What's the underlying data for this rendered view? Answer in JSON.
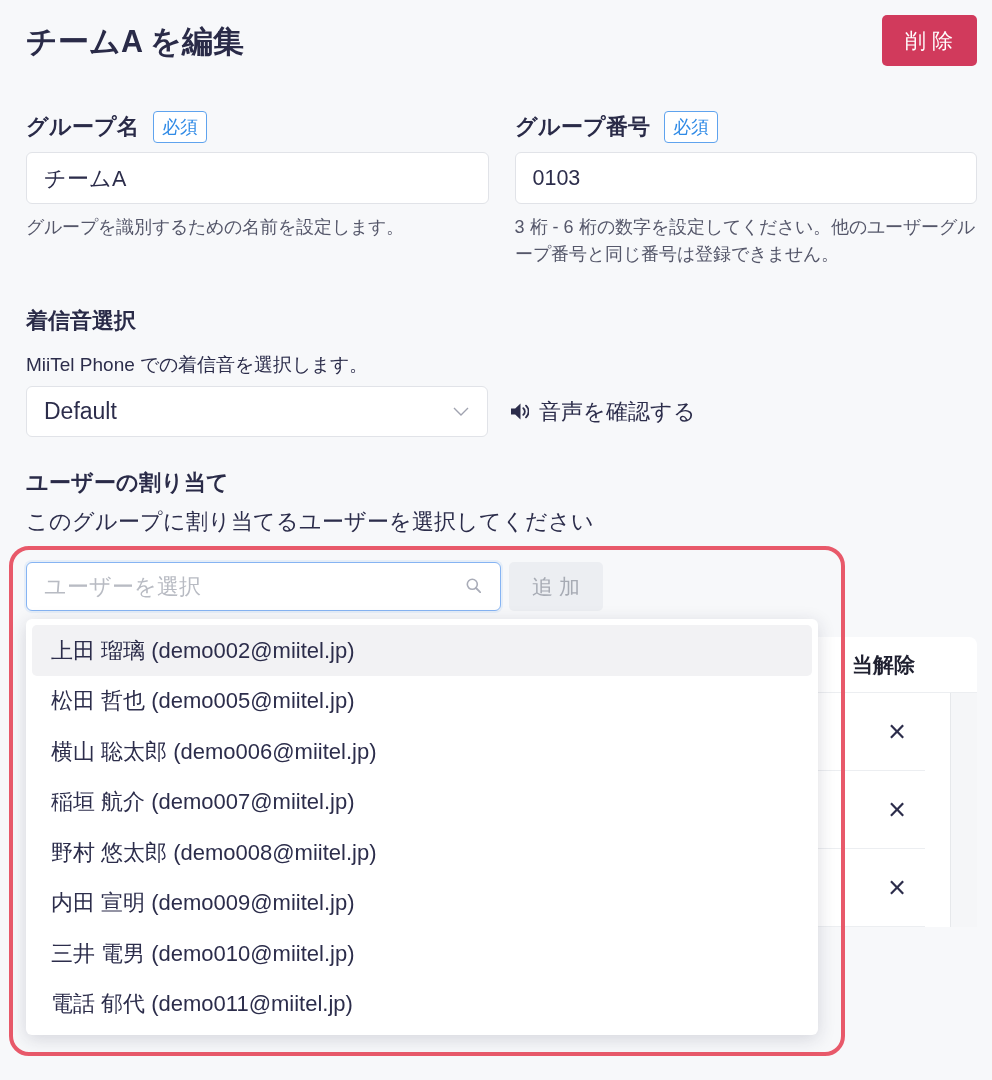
{
  "page": {
    "title": "チームA を編集",
    "delete_button": "削除"
  },
  "group_name": {
    "label": "グループ名",
    "badge": "必須",
    "value": "チームA",
    "help": "グループを識別するための名前を設定します。"
  },
  "group_number": {
    "label": "グループ番号",
    "badge": "必須",
    "value": "0103",
    "help": "3 桁 - 6 桁の数字を設定してください。他のユーザーグループ番号と同じ番号は登録できません。"
  },
  "ringtone": {
    "label": "着信音選択",
    "description": "MiiTel Phone での着信音を選択します。",
    "value": "Default",
    "preview_link": "音声を確認する"
  },
  "user_assignment": {
    "label": "ユーザーの割り当て",
    "description": "このグループに割り当てるユーザーを選択してください",
    "highlighted": true,
    "search": {
      "placeholder": "ユーザーを選択",
      "focused": true
    },
    "add_button": {
      "label": "追加",
      "disabled": true
    },
    "dropdown": {
      "items": [
        {
          "name": "上田 瑠璃 (demo002@miitel.jp)",
          "selected": true
        },
        {
          "name": "松田 哲也 (demo005@miitel.jp)",
          "selected": false
        },
        {
          "name": "横山 聡太郎 (demo006@miitel.jp)",
          "selected": false
        },
        {
          "name": "稲垣 航介 (demo007@miitel.jp)",
          "selected": false
        },
        {
          "name": "野村 悠太郎 (demo008@miitel.jp)",
          "selected": false
        },
        {
          "name": "内田 宣明 (demo009@miitel.jp)",
          "selected": false
        },
        {
          "name": "三井 電男 (demo010@miitel.jp)",
          "selected": false
        },
        {
          "name": "電話 郁代 (demo011@miitel.jp)",
          "selected": false
        }
      ]
    },
    "table": {
      "columns": [
        "当解除"
      ],
      "rows": [
        {
          "remove": "×"
        },
        {
          "remove": "×"
        },
        {
          "remove": "×"
        }
      ]
    }
  }
}
